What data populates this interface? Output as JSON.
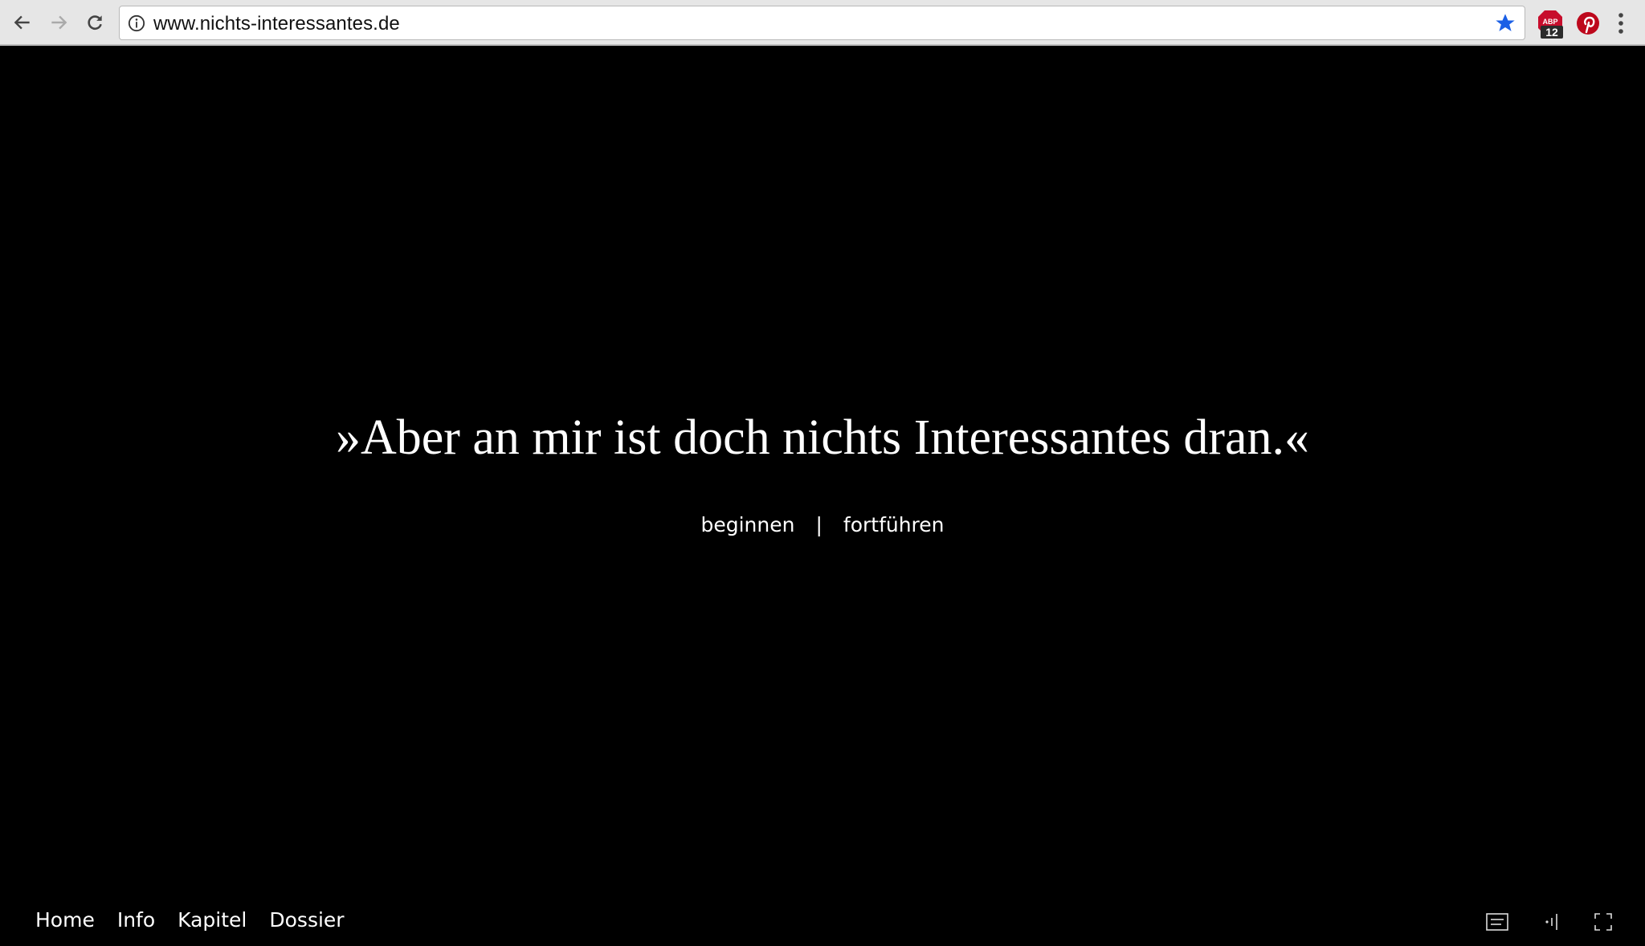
{
  "browser": {
    "url": "www.nichts-interessantes.de",
    "back_icon": "arrow-left-icon",
    "forward_icon": "arrow-right-icon",
    "reload_icon": "reload-icon",
    "site_info_icon": "info-icon",
    "bookmark_icon": "star-icon",
    "bookmark_color": "#1a73e8",
    "extensions": [
      {
        "name": "adblock-plus",
        "icon": "abp-icon",
        "badge": "12",
        "color": "#c70d2c"
      },
      {
        "name": "pinterest",
        "icon": "pinterest-icon",
        "color": "#bd081c"
      }
    ],
    "menu_icon": "more-vert-icon"
  },
  "page": {
    "quote": "»Aber an mir ist doch nichts Interessantes dran.«",
    "actions": {
      "begin": "beginnen",
      "separator": "|",
      "continue": "fortführen"
    },
    "bottom_nav": [
      "Home",
      "Info",
      "Kapitel",
      "Dossier"
    ],
    "controls": [
      {
        "name": "subtitles-button",
        "icon": "subtitles-icon"
      },
      {
        "name": "audio-button",
        "icon": "audio-level-icon"
      },
      {
        "name": "fullscreen-button",
        "icon": "fullscreen-icon"
      }
    ]
  }
}
